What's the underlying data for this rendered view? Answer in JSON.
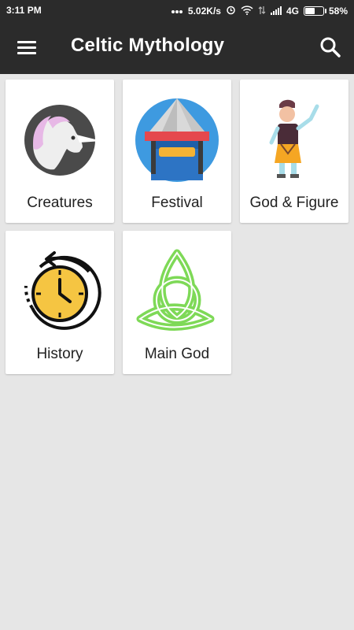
{
  "status_bar": {
    "time": "3:11 PM",
    "speed": "5.02K/s",
    "network": "4G",
    "battery_percent": "58%",
    "battery_level": 0.58
  },
  "app_bar": {
    "title": "Celtic Mythology",
    "menu_icon": "hamburger-menu-icon",
    "search_icon": "search-icon"
  },
  "categories": [
    {
      "label": "Creatures",
      "icon": "unicorn-icon"
    },
    {
      "label": "Festival",
      "icon": "tent-icon"
    },
    {
      "label": "God & Figure",
      "icon": "person-icon"
    },
    {
      "label": "History",
      "icon": "clock-history-icon"
    },
    {
      "label": "Main God",
      "icon": "triquetra-icon"
    }
  ],
  "colors": {
    "app_bar": "#2b2b2b",
    "background": "#e6e6e6",
    "card": "#ffffff"
  }
}
